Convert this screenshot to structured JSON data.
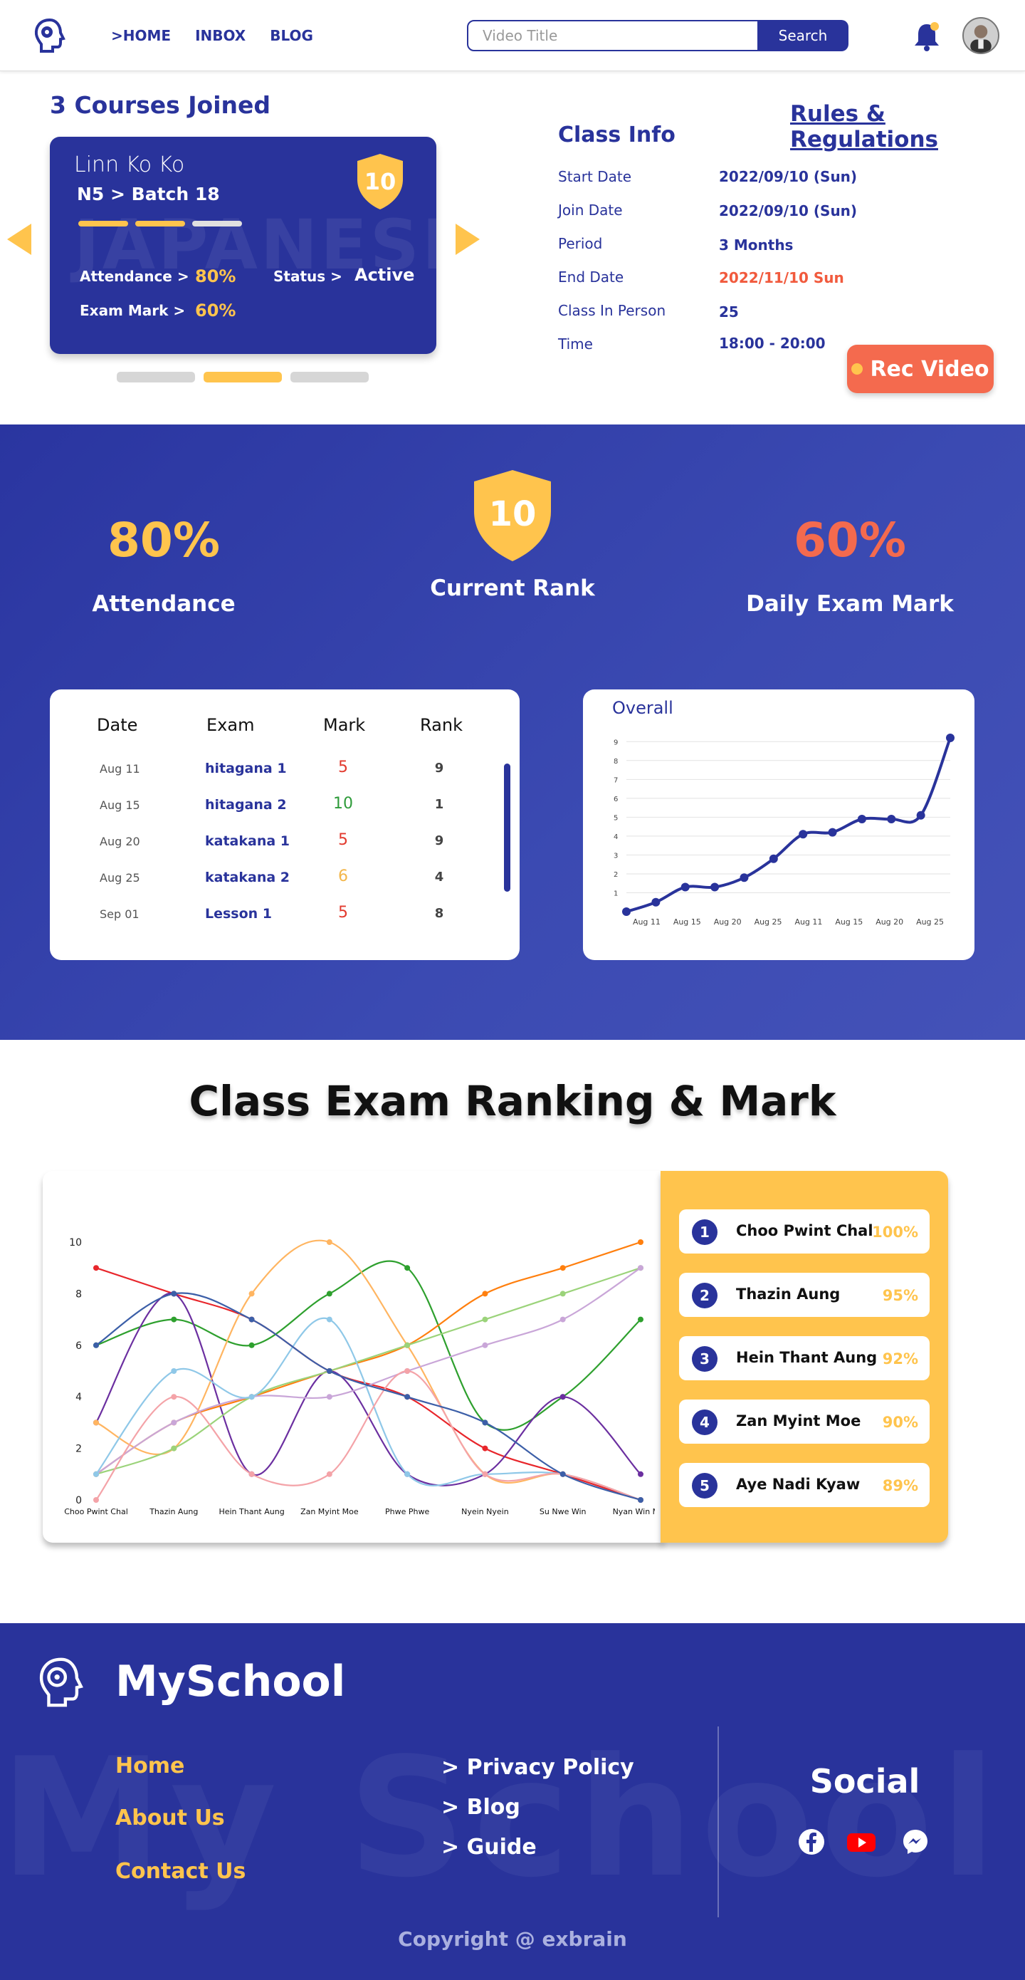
{
  "nav": {
    "links": [
      ">HOME",
      "INBOX",
      "BLOG"
    ],
    "search_placeholder": "Video Title",
    "search_label": "Search"
  },
  "courses": {
    "title": "3 Courses Joined",
    "card": {
      "name": "Linn Ko Ko",
      "batch": "N5 > Batch 18",
      "bg_text": "JAPANESE",
      "rank": "10",
      "attendance_label": "Attendance >",
      "attendance_value": "80%",
      "status_label": "Status >",
      "status_value": "Active",
      "exam_label": "Exam Mark >",
      "exam_value": "60%"
    }
  },
  "rules_link": "Rules & Regulations",
  "class_info": {
    "title": "Class Info",
    "rows": [
      {
        "label": "Start Date",
        "value": "2022/09/10 (Sun)"
      },
      {
        "label": "Join Date",
        "value": "2022/09/10 (Sun)"
      },
      {
        "label": "Period",
        "value": "3 Months"
      },
      {
        "label": "End Date",
        "value": "2022/11/10 Sun"
      },
      {
        "label": "Class In Person",
        "value": "25"
      },
      {
        "label": "Time",
        "value": "18:00 - 20:00"
      }
    ],
    "rec_button": "Rec Video"
  },
  "stats": {
    "attendance_value": "80%",
    "attendance_label": "Attendance",
    "rank_value": "10",
    "rank_label": "Current Rank",
    "exam_value": "60%",
    "exam_label": "Daily Exam Mark"
  },
  "exam_table": {
    "headers": [
      "Date",
      "Exam",
      "Mark",
      "Rank"
    ],
    "rows": [
      {
        "date": "Aug 11",
        "exam": "hitagana 1",
        "mark": "5",
        "mark_color": "#e23a2e",
        "rank": "9"
      },
      {
        "date": "Aug 15",
        "exam": "hitagana 2",
        "mark": "10",
        "mark_color": "#2e9b3a",
        "rank": "1"
      },
      {
        "date": "Aug 20",
        "exam": "katakana 1",
        "mark": "5",
        "mark_color": "#e23a2e",
        "rank": "9"
      },
      {
        "date": "Aug 25",
        "exam": "katakana 2",
        "mark": "6",
        "mark_color": "#f3b64a",
        "rank": "4"
      },
      {
        "date": "Sep 01",
        "exam": "Lesson 1",
        "mark": "5",
        "mark_color": "#e23a2e",
        "rank": "8"
      }
    ]
  },
  "chart_data": [
    {
      "type": "line",
      "title": "Overall",
      "x": [
        "",
        "Aug 11",
        "",
        "Aug 15",
        "",
        "Aug 20",
        "",
        "Aug 25",
        "",
        "Aug 11",
        "",
        "Aug 15",
        "",
        "Aug 20",
        "",
        "Aug 25",
        ""
      ],
      "values": [
        0,
        0.5,
        1.3,
        1.3,
        1.8,
        2.8,
        4.1,
        4.2,
        4.9,
        4.9,
        5.1,
        9.2
      ],
      "yticks": [
        1,
        2,
        3,
        4,
        5,
        6,
        7,
        8,
        9
      ],
      "ylim": [
        0,
        9.5
      ],
      "color": "#29339b",
      "grid": true
    },
    {
      "type": "line",
      "title": "",
      "categories": [
        "Choo Pwint Chal",
        "Thazin Aung",
        "Hein Thant Aung",
        "Zan Myint Moe",
        "Phwe Phwe",
        "Nyein Nyein",
        "Su Nwe Win",
        "Nyan Win Myo"
      ],
      "ylim": [
        0,
        10
      ],
      "yticks": [
        0,
        2,
        4,
        6,
        8,
        10
      ],
      "series": [
        {
          "color": "#e8262b",
          "values": [
            9,
            8,
            7,
            5,
            4,
            2,
            1,
            0
          ]
        },
        {
          "color": "#2ea02e",
          "values": [
            6,
            7,
            6,
            8,
            9,
            3,
            4,
            7
          ]
        },
        {
          "color": "#6b2fa0",
          "values": [
            3,
            8,
            1,
            5,
            1,
            1,
            4,
            1
          ]
        },
        {
          "color": "#ffb561",
          "values": [
            3,
            2,
            8,
            10,
            6,
            1,
            1,
            0
          ]
        },
        {
          "color": "#ff7f0e",
          "values": [
            1,
            3,
            4,
            5,
            6,
            8,
            9,
            10
          ]
        },
        {
          "color": "#9bd37a",
          "values": [
            1,
            2,
            4,
            5,
            6,
            7,
            8,
            9
          ]
        },
        {
          "color": "#c9a6d8",
          "values": [
            1,
            3,
            4,
            4,
            5,
            6,
            7,
            9
          ]
        },
        {
          "color": "#8fc8e8",
          "values": [
            1,
            5,
            4,
            7,
            1,
            1,
            1,
            0
          ]
        },
        {
          "color": "#f4a3a8",
          "values": [
            0,
            4,
            1,
            1,
            5,
            1,
            1,
            0
          ]
        },
        {
          "color": "#3c5fa8",
          "values": [
            6,
            8,
            7,
            5,
            4,
            3,
            1,
            0
          ]
        }
      ]
    }
  ],
  "ranking": {
    "title": "Class Exam Ranking & Mark",
    "items": [
      {
        "num": "1",
        "name": "Choo Pwint Chal",
        "pct": "100%"
      },
      {
        "num": "2",
        "name": "Thazin Aung",
        "pct": "95%"
      },
      {
        "num": "3",
        "name": "Hein Thant Aung",
        "pct": "92%"
      },
      {
        "num": "4",
        "name": "Zan Myint Moe",
        "pct": "90%"
      },
      {
        "num": "5",
        "name": "Aye Nadi Kyaw",
        "pct": "89%"
      }
    ]
  },
  "footer": {
    "brand": "MySchool",
    "bg_text": "My School",
    "links_left": [
      "Home",
      "About Us",
      "Contact Us"
    ],
    "links_right": [
      "> Privacy Policy",
      "> Blog",
      "> Guide"
    ],
    "social_title": "Social",
    "social_icons": [
      "facebook-icon",
      "youtube-icon",
      "messenger-icon"
    ],
    "copyright": "Copyright @ exbrain"
  }
}
